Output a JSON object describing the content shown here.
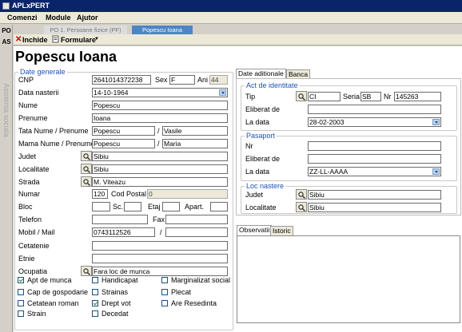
{
  "window": {
    "title": "APLxPERT"
  },
  "menu": [
    "Comenzi",
    "Module",
    "Ajutor"
  ],
  "side": {
    "po": "PO",
    "as": "AS",
    "vertical": "Asistenta sociala"
  },
  "tabs": {
    "pf": "PO 1. Persoane fizice (PF)",
    "pi": "Popescu Ioana"
  },
  "toolbar": {
    "close": "Inchide",
    "forms": "Formulare"
  },
  "page": {
    "title": "Popescu Ioana"
  },
  "general": {
    "legend": "Date generale",
    "cnp_label": "CNP",
    "cnp": "2641014372238",
    "sex_label": "Sex",
    "sex": "F",
    "ani_label": "Ani",
    "ani": "44",
    "dob_label": "Data nasterii",
    "dob": "14-10-1964",
    "nume_label": "Nume",
    "nume": "Popescu",
    "prenume_label": "Prenume",
    "prenume": "Ioana",
    "tata_label": "Tata Nume / Prenume",
    "tata_nume": "Popescu",
    "tata_prenume": "Vasile",
    "mama_label": "Mama Nume / Prenume",
    "mama_nume": "Popescu",
    "mama_prenume": "Maria",
    "judet_label": "Judet",
    "judet": "Sibiu",
    "localitate_label": "Localitate",
    "localitate": "Sibiu",
    "strada_label": "Strada",
    "strada": "M. Viteazu",
    "numar_label": "Numar",
    "numar": "120",
    "cod_label": "Cod Postal",
    "cod": "0",
    "bloc_label": "Bloc",
    "sc_label": "Sc.",
    "etaj_label": "Etaj",
    "apart_label": "Apart.",
    "telefon_label": "Telefon",
    "fax_label": "Fax",
    "mobil_label": "Mobil / Mail",
    "mobil": "0743112526",
    "cetatenie_label": "Cetatenie",
    "etnie_label": "Etnie",
    "ocupatia_label": "Ocupatia",
    "ocupatia": "Fara loc de munca",
    "slash": "/"
  },
  "checkboxes": [
    {
      "label": "Apt de munca",
      "checked": true
    },
    {
      "label": "Cap de gospodarie",
      "checked": false
    },
    {
      "label": "Cetatean roman",
      "checked": false
    },
    {
      "label": "Strain",
      "checked": false
    },
    {
      "label": "Handicapat",
      "checked": false
    },
    {
      "label": "Strainas",
      "checked": false
    },
    {
      "label": "Drept vot",
      "checked": true
    },
    {
      "label": "Decedat",
      "checked": false
    },
    {
      "label": "Marginalizat social",
      "checked": false
    },
    {
      "label": "Plecat",
      "checked": false
    },
    {
      "label": "Are Resedinta",
      "checked": false
    }
  ],
  "right_tabs": [
    "Date aditionale",
    "Banca"
  ],
  "act": {
    "legend": "Act de identitate",
    "tip_label": "Tip",
    "tip": "CI",
    "seria_label": "Seria",
    "seria": "SB",
    "nr_label": "Nr",
    "nr": "145263",
    "eliberat_label": "Eliberat de",
    "data_label": "La data",
    "data": "28-02-2003"
  },
  "pasaport": {
    "legend": "Pasaport",
    "nr_label": "Nr",
    "eliberat_label": "Eliberat de",
    "data_label": "La data",
    "data": "ZZ-LL-AAAA"
  },
  "loc": {
    "legend": "Loc nastere",
    "judet_label": "Judet",
    "judet": "Sibiu",
    "localitate_label": "Localitate",
    "localitate": "Sibiu"
  },
  "bottom_tabs": [
    "Observatii",
    "Istoric"
  ]
}
